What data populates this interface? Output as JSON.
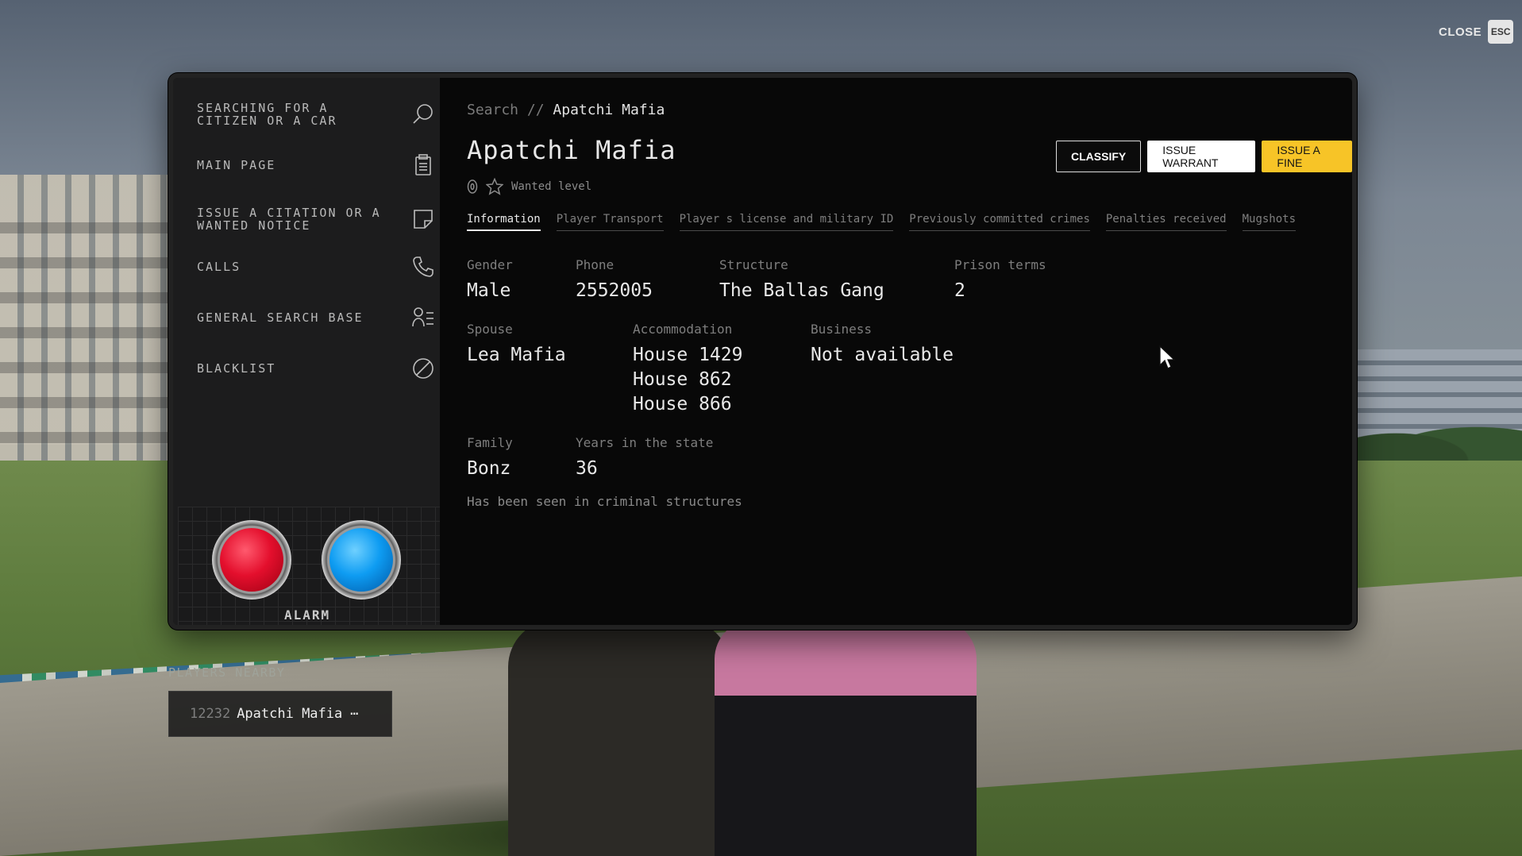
{
  "close": {
    "label": "CLOSE",
    "key": "ESC"
  },
  "sidebar": {
    "items": [
      {
        "label": "SEARCHING FOR A CITIZEN OR A CAR",
        "icon": "search-icon"
      },
      {
        "label": "MAIN PAGE",
        "icon": "clipboard-icon"
      },
      {
        "label": "ISSUE A CITATION OR A WANTED NOTICE",
        "icon": "note-icon"
      },
      {
        "label": "CALLS",
        "icon": "phone-icon"
      },
      {
        "label": "GENERAL SEARCH BASE",
        "icon": "user-list-icon"
      },
      {
        "label": "BLACKLIST",
        "icon": "ban-icon"
      }
    ],
    "alarm": {
      "label": "ALARM",
      "colors": {
        "red": "#e40f2d",
        "blue": "#0e9cf2"
      }
    }
  },
  "breadcrumb": {
    "root": "Search",
    "separator": "//",
    "current": "Apatchi Mafia"
  },
  "profile": {
    "name": "Apatchi Mafia",
    "wanted_label": "Wanted level",
    "wanted_level": 0
  },
  "actions": {
    "classify": "CLASSIFY",
    "warrant": "ISSUE WARRANT",
    "fine": "ISSUE A FINE",
    "accent": "#f7c427"
  },
  "tabs": [
    "Information",
    "Player Transport",
    "Player s license and military ID",
    "Previously committed crimes",
    "Penalties received",
    "Mugshots"
  ],
  "info": {
    "gender": {
      "label": "Gender",
      "value": "Male"
    },
    "phone": {
      "label": "Phone",
      "value": "2552005"
    },
    "structure": {
      "label": "Structure",
      "value": "The Ballas Gang"
    },
    "prison": {
      "label": "Prison terms",
      "value": "2"
    },
    "spouse": {
      "label": "Spouse",
      "value": "Lea Mafia"
    },
    "accommodation": {
      "label": "Accommodation",
      "values": [
        "House 1429",
        "House 862",
        "House 866"
      ]
    },
    "business": {
      "label": "Business",
      "value": "Not available"
    },
    "family": {
      "label": "Family",
      "value": "Bonz"
    },
    "years": {
      "label": "Years in the state",
      "value": "36"
    },
    "note": "Has been seen in criminal structures"
  },
  "nearby": {
    "title": "PLAYERS NEARBY",
    "players": [
      {
        "id": "12232",
        "name": "Apatchi Mafia",
        "more": "⋯"
      }
    ]
  }
}
